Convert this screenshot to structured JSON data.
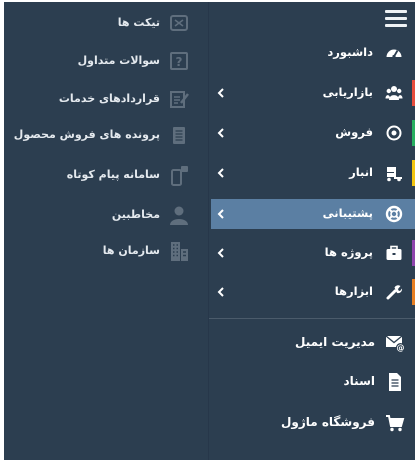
{
  "main_menu": {
    "items": [
      {
        "label": "داشبورد",
        "icon": "dashboard-icon",
        "has_submenu": false,
        "active": false
      },
      {
        "label": "بازاریابی",
        "icon": "users-icon",
        "has_submenu": true,
        "active": false,
        "accent": "#e74c3c"
      },
      {
        "label": "فروش",
        "icon": "target-icon",
        "has_submenu": true,
        "active": false,
        "accent": "#27ae60"
      },
      {
        "label": "انبار",
        "icon": "truck-icon",
        "has_submenu": true,
        "active": false,
        "accent": "#f1c40f"
      },
      {
        "label": "پشتیبانی",
        "icon": "lifebuoy-icon",
        "has_submenu": true,
        "active": true,
        "accent": "#5b7fa3"
      },
      {
        "label": "پروژه ها",
        "icon": "briefcase-icon",
        "has_submenu": true,
        "active": false,
        "accent": "#8e44ad"
      },
      {
        "label": "ابزارها",
        "icon": "wrench-icon",
        "has_submenu": true,
        "active": false,
        "accent": "#e67e22"
      }
    ]
  },
  "bottom_menu": {
    "items": [
      {
        "label": "مدیریت ایمیل",
        "icon": "email-at-icon"
      },
      {
        "label": "اسناد",
        "icon": "document-icon"
      },
      {
        "label": "فروشگاه ماژول",
        "icon": "shopping-cart-icon"
      }
    ]
  },
  "submenu": {
    "items": [
      {
        "label": "تیکت ها",
        "icon": "ticket-icon"
      },
      {
        "label": "سوالات متداول",
        "icon": "question-icon"
      },
      {
        "label": "قراردادهای خدمات",
        "icon": "contract-edit-icon"
      },
      {
        "label": "پرونده های فروش محصول",
        "icon": "file-list-icon"
      },
      {
        "label": "سامانه پیام کوتاه",
        "icon": "sms-phone-icon"
      },
      {
        "label": "مخاطبین",
        "icon": "contact-person-icon"
      },
      {
        "label": "سازمان ها",
        "icon": "organization-building-icon"
      }
    ]
  },
  "colors": {
    "panel_bg": "#2c3e50",
    "active_bg": "#5b7fa3",
    "text": "#ffffff",
    "muted_icon": "#5f6e7d"
  }
}
